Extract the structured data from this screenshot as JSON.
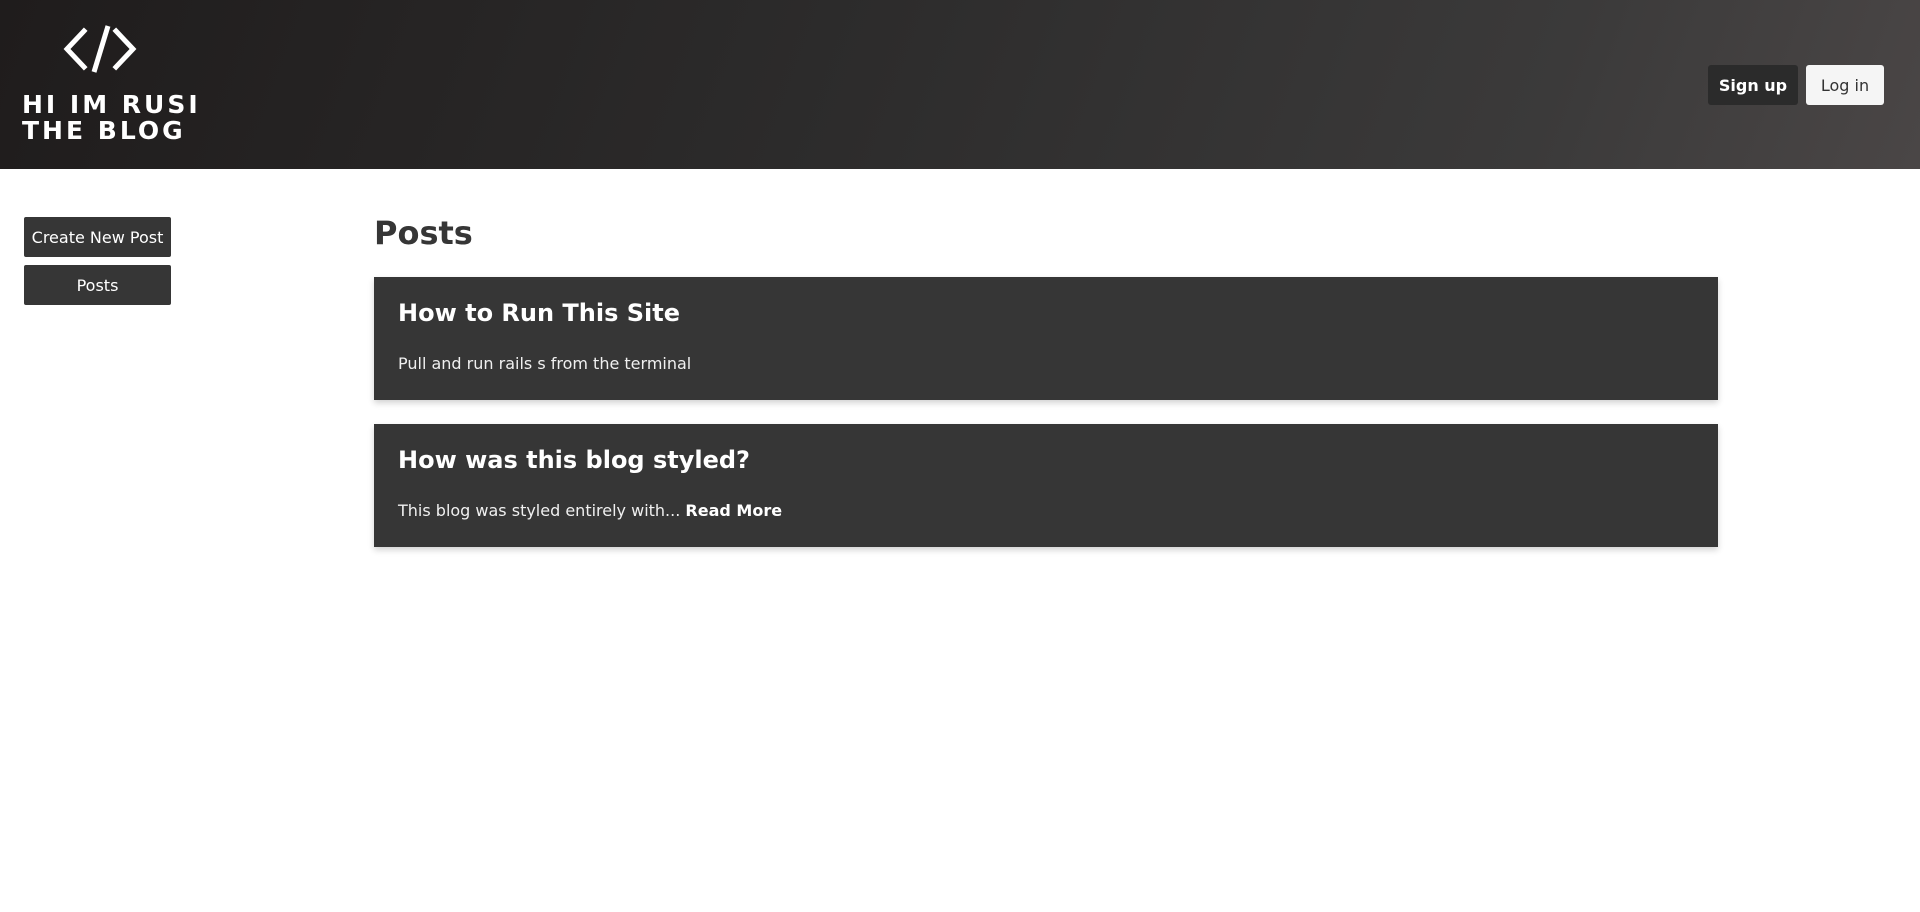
{
  "header": {
    "logo": {
      "icon": "code-brackets-icon",
      "line1": "HI IM RUSI",
      "line2": "THE BLOG"
    },
    "signup_label": "Sign up",
    "login_label": "Log in"
  },
  "sidebar": {
    "items": [
      {
        "label": "Create New Post"
      },
      {
        "label": "Posts"
      }
    ]
  },
  "main": {
    "title": "Posts",
    "posts": [
      {
        "title": "How to Run This Site",
        "excerpt": "Pull and run rails s from the terminal",
        "read_more": ""
      },
      {
        "title": "How was this blog styled?",
        "excerpt": "This blog was styled entirely with...",
        "read_more": "Read More"
      }
    ]
  },
  "colors": {
    "header_bg": "#2d2c2c",
    "card_bg": "#363636",
    "signup_bg": "#2b2b2b",
    "login_bg": "#f5f5f5"
  }
}
